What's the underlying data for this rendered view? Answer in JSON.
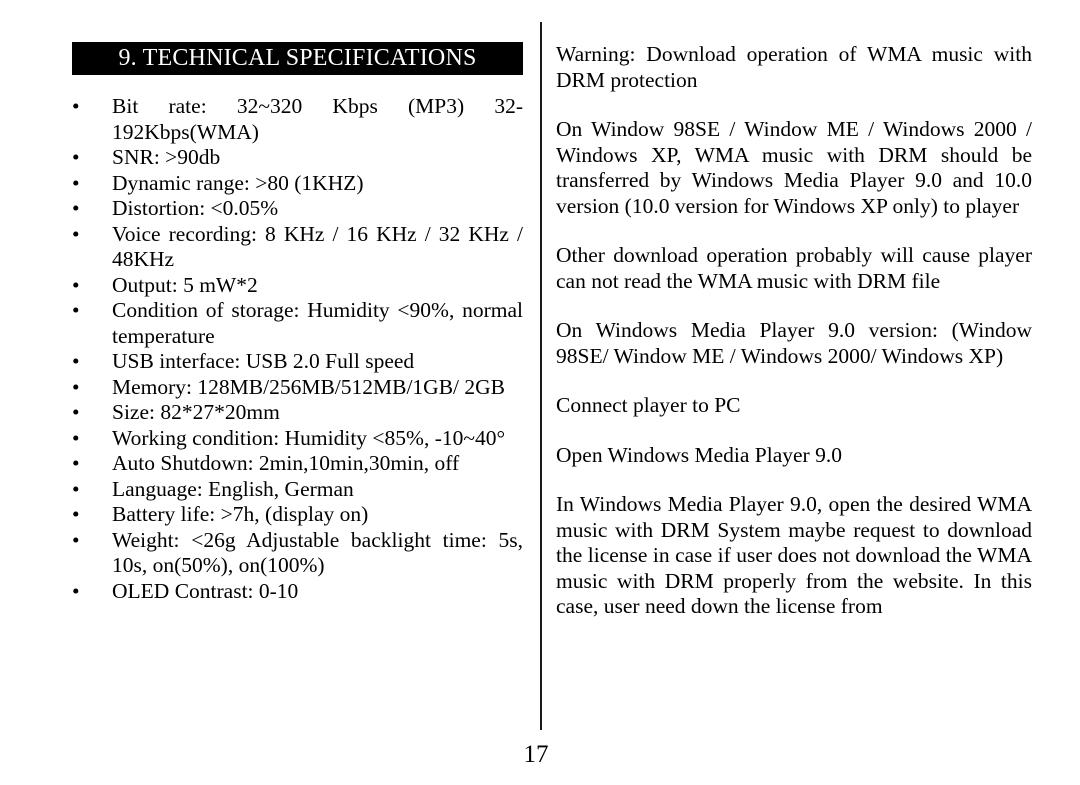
{
  "document": {
    "page_number": "17",
    "left_column": {
      "heading": "9. TECHNICAL SPECIFICATIONS",
      "bullet_glyph": "•",
      "specs": [
        "Bit rate: 32~320 Kbps (MP3) 32-192Kbps(WMA)",
        "SNR: >90db",
        "Dynamic range: >80 (1KHZ)",
        "Distortion: <0.05%",
        "Voice recording: 8 KHz / 16 KHz / 32 KHz / 48KHz",
        "Output: 5 mW*2",
        "Condition of storage: Humidity <90%, normal temperature",
        "USB interface: USB 2.0 Full speed",
        "Memory: 128MB/256MB/512MB/1GB/ 2GB",
        "Size: 82*27*20mm",
        "Working condition: Humidity <85%, -10~40°",
        "Auto Shutdown: 2min,10min,30min, off",
        "Language: English, German",
        "Battery life: >7h, (display on)",
        "Weight: <26g Adjustable backlight time: 5s, 10s, on(50%), on(100%)",
        "OLED Contrast: 0-10"
      ]
    },
    "right_column": {
      "paragraphs": [
        "Warning: Download operation of WMA music with DRM protection",
        "On Window 98SE / Window ME / Windows 2000 / Windows XP, WMA music with DRM should be transferred by Windows Media Player 9.0 and 10.0 version (10.0 version for Windows XP only) to player",
        "Other download operation probably will cause player can not read the WMA music with DRM file",
        "On Windows Media Player 9.0 version: (Window 98SE/ Window ME / Windows 2000/ Windows XP)",
        "Connect player to PC",
        "Open Windows Media Player 9.0",
        "In Windows Media Player 9.0, open the desired WMA music with DRM System maybe request to download the license in case if user does not download the WMA music with DRM  properly from the website. In this case, user need down the license from"
      ]
    }
  }
}
